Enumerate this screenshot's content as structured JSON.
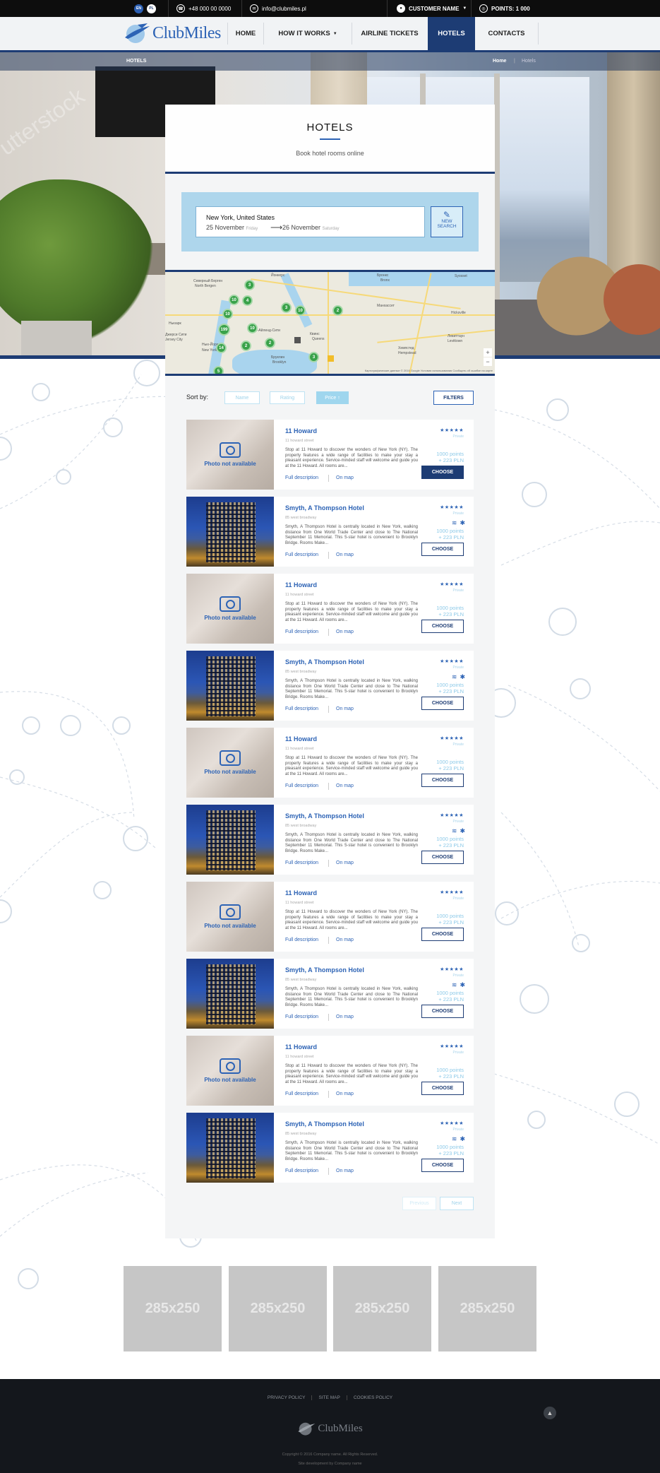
{
  "topbar": {
    "lang_en": "EN",
    "lang_pl": "PL",
    "phone": "+48 000 00 0000",
    "email": "info@clubmiles.pl",
    "customer": "CUSTOMER NAME",
    "points": "POINTS: 1 000"
  },
  "nav": {
    "logo": "ClubMiles",
    "home": "HOME",
    "how": "HOW IT WORKS",
    "airline": "AIRLINE TICKETS",
    "hotels": "HOTELS",
    "contacts": "CONTACTS"
  },
  "breadcrumb": {
    "section": "HOTELS",
    "home": "Home",
    "current": "Hotels"
  },
  "hero_watermark": "utterstock",
  "page": {
    "title": "HOTELS",
    "subtitle": "Book hotel rooms online"
  },
  "search": {
    "location": "New York, United States",
    "date_from": "25 November",
    "day_from": "Friday",
    "date_to": "26 November",
    "day_to": "Saturday",
    "new_search": "NEW SEARCH"
  },
  "map": {
    "labels": [
      "Северный Берген",
      "North Bergen",
      "Бронкс",
      "Bronx",
      "Йонкерс",
      "Ньюарк",
      "Нью-Йорк",
      "New York",
      "Джерси Сити",
      "Jersey City",
      "Лонг-Айленд-Сити",
      "Квинс",
      "Queens",
      "Бруклин",
      "Brooklyn",
      "Хемпстед",
      "Hempstead",
      "Левиттаун",
      "Levittown",
      "Hicksville",
      "Syosset",
      "Манхассет"
    ],
    "clusters": [
      "3",
      "10",
      "4",
      "10",
      "3",
      "10",
      "2",
      "199",
      "10",
      "2",
      "2",
      "3",
      "14",
      "5"
    ],
    "attribution": "Картографические данные © 2016 Google   Условия использования   Сообщить об ошибке на карте"
  },
  "sort": {
    "label": "Sort by:",
    "name": "Name",
    "rating": "Rating",
    "price": "Price ↑",
    "filters": "FILTERS"
  },
  "hotels": [
    {
      "name": "11 Howard",
      "address": "11 howard street",
      "type": "na",
      "photo_text": "Photo not available",
      "desc": "Stop at 11 Howard to discover the wonders of New York (NY). The property features a wide range of facilities to make your stay a pleasant experience. Service-minded staff will welcome and guide you at the 11 Howard. All rooms are...",
      "stars": "★★★★★",
      "stars_label": "Private",
      "points": "1000 points",
      "price": "+ 223 PLN",
      "full": "Full description",
      "onmap": "On map",
      "choose": "CHOOSE",
      "filled": true
    },
    {
      "name": "Smyth, A Thompson Hotel",
      "address": "85 west broadway",
      "type": "bld",
      "desc": "Smyth, A Thompson Hotel is centrally located in New York, walking distance from One World Trade Center and close to The National September 11 Memorial. This 5-star hotel is convenient to Brooklyn Bridge. Rooms Make...",
      "stars": "★★★★★",
      "stars_label": "Private",
      "points": "1000 points",
      "price": "+ 223 PLN",
      "full": "Full description",
      "onmap": "On map",
      "choose": "CHOOSE",
      "filled": false
    },
    {
      "name": "11 Howard",
      "address": "11 howard street",
      "type": "na",
      "photo_text": "Photo not available",
      "desc": "Stop at 11 Howard to discover the wonders of New York (NY). The property features a wide range of facilities to make your stay a pleasant experience. Service-minded staff will welcome and guide you at the 11 Howard. All rooms are...",
      "stars": "★★★★★",
      "stars_label": "Private",
      "points": "1000 points",
      "price": "+ 223 PLN",
      "full": "Full description",
      "onmap": "On map",
      "choose": "CHOOSE",
      "filled": false
    },
    {
      "name": "Smyth, A Thompson Hotel",
      "address": "85 west broadway",
      "type": "bld",
      "desc": "Smyth, A Thompson Hotel is centrally located in New York, walking distance from One World Trade Center and close to The National September 11 Memorial. This 5-star hotel is convenient to Brooklyn Bridge. Rooms Make...",
      "stars": "★★★★★",
      "stars_label": "Private",
      "points": "1000 points",
      "price": "+ 223 PLN",
      "full": "Full description",
      "onmap": "On map",
      "choose": "CHOOSE",
      "filled": false
    },
    {
      "name": "11 Howard",
      "address": "11 howard street",
      "type": "na",
      "photo_text": "Photo not available",
      "desc": "Stop at 11 Howard to discover the wonders of New York (NY). The property features a wide range of facilities to make your stay a pleasant experience. Service-minded staff will welcome and guide you at the 11 Howard. All rooms are...",
      "stars": "★★★★★",
      "stars_label": "Private",
      "points": "1000 points",
      "price": "+ 223 PLN",
      "full": "Full description",
      "onmap": "On map",
      "choose": "CHOOSE",
      "filled": false
    },
    {
      "name": "Smyth, A Thompson Hotel",
      "address": "85 west broadway",
      "type": "bld",
      "desc": "Smyth, A Thompson Hotel is centrally located in New York, walking distance from One World Trade Center and close to The National September 11 Memorial. This 5-star hotel is convenient to Brooklyn Bridge. Rooms Make...",
      "stars": "★★★★★",
      "stars_label": "Private",
      "points": "1000 points",
      "price": "+ 223 PLN",
      "full": "Full description",
      "onmap": "On map",
      "choose": "CHOOSE",
      "filled": false
    },
    {
      "name": "11 Howard",
      "address": "11 howard street",
      "type": "na",
      "photo_text": "Photo not available",
      "desc": "Stop at 11 Howard to discover the wonders of New York (NY). The property features a wide range of facilities to make your stay a pleasant experience. Service-minded staff will welcome and guide you at the 11 Howard. All rooms are...",
      "stars": "★★★★★",
      "stars_label": "Private",
      "points": "1000 points",
      "price": "+ 223 PLN",
      "full": "Full description",
      "onmap": "On map",
      "choose": "CHOOSE",
      "filled": false
    },
    {
      "name": "Smyth, A Thompson Hotel",
      "address": "85 west broadway",
      "type": "bld",
      "desc": "Smyth, A Thompson Hotel is centrally located in New York, walking distance from One World Trade Center and close to The National September 11 Memorial. This 5-star hotel is convenient to Brooklyn Bridge. Rooms Make...",
      "stars": "★★★★★",
      "stars_label": "Private",
      "points": "1000 points",
      "price": "+ 223 PLN",
      "full": "Full description",
      "onmap": "On map",
      "choose": "CHOOSE",
      "filled": false
    },
    {
      "name": "11 Howard",
      "address": "11 howard street",
      "type": "na",
      "photo_text": "Photo not available",
      "desc": "Stop at 11 Howard to discover the wonders of New York (NY). The property features a wide range of facilities to make your stay a pleasant experience. Service-minded staff will welcome and guide you at the 11 Howard. All rooms are...",
      "stars": "★★★★★",
      "stars_label": "Private",
      "points": "1000 points",
      "price": "+ 223 PLN",
      "full": "Full description",
      "onmap": "On map",
      "choose": "CHOOSE",
      "filled": false
    },
    {
      "name": "Smyth, A Thompson Hotel",
      "address": "85 west broadway",
      "type": "bld",
      "desc": "Smyth, A Thompson Hotel is centrally located in New York, walking distance from One World Trade Center and close to The National September 11 Memorial. This 5-star hotel is convenient to Brooklyn Bridge. Rooms Make...",
      "stars": "★★★★★",
      "stars_label": "Private",
      "points": "1000 points",
      "price": "+ 223 PLN",
      "full": "Full description",
      "onmap": "On map",
      "choose": "CHOOSE",
      "filled": false
    }
  ],
  "pager": {
    "prev": "Previous",
    "next": "Next"
  },
  "ads": [
    "285x250",
    "285x250",
    "285x250",
    "285x250"
  ],
  "footer": {
    "privacy": "PRIVACY POLICY",
    "sitemap": "SITE MAP",
    "cookies": "COOKIES POLICY",
    "logo": "ClubMiles",
    "copyright": "Copyright © 2016 Company name. All Rights Reserved.",
    "developer": "Site development by Company name"
  },
  "colors": {
    "brand_dark": "#1d3c74",
    "brand_blue": "#2d63b5",
    "light_blue": "#8cc9e8",
    "map_cluster": "#39a24a"
  }
}
